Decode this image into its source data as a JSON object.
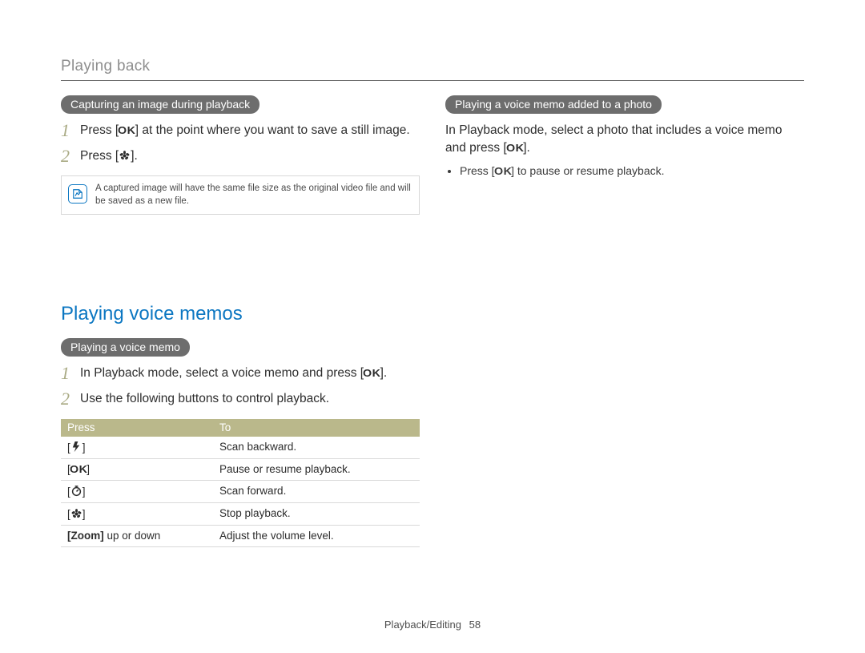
{
  "header": {
    "section_label": "Playing back"
  },
  "left": {
    "sub1": {
      "pill": "Capturing an image during playback",
      "steps": [
        {
          "n": "1",
          "pre": "Press [",
          "icon": "ok",
          "post": "] at the point where you want to save a still image."
        },
        {
          "n": "2",
          "pre": "Press [",
          "icon": "flower",
          "post": "]."
        }
      ],
      "note": "A captured image will have the same file size as the original video file and will be saved as a new file."
    },
    "section_title": "Playing voice memos",
    "sub2": {
      "pill": "Playing a voice memo",
      "steps": [
        {
          "n": "1",
          "pre": "In Playback mode, select a voice memo and press [",
          "icon": "ok",
          "post": "]."
        },
        {
          "n": "2",
          "text": "Use the following buttons to control playback."
        }
      ],
      "table": {
        "head": [
          "Press",
          "To"
        ],
        "rows": [
          {
            "icon": "flash",
            "label_pre": "[",
            "label_post": "]",
            "to": "Scan backward."
          },
          {
            "icon": "ok",
            "label_pre": "[",
            "label_post": "]",
            "to": "Pause or resume playback."
          },
          {
            "icon": "timer",
            "label_pre": "[",
            "label_post": "]",
            "to": "Scan forward."
          },
          {
            "icon": "flower",
            "label_pre": "[",
            "label_post": "]",
            "to": "Stop playback."
          },
          {
            "text_key": "[Zoom] up or down",
            "to": "Adjust the volume level."
          }
        ]
      }
    }
  },
  "right": {
    "sub": {
      "pill": "Playing a voice memo added to a photo",
      "para_pre": "In Playback mode, select a photo that includes a voice memo and press [",
      "para_icon": "ok",
      "para_post": "].",
      "bullet_pre": "Press [",
      "bullet_icon": "ok",
      "bullet_post": "] to pause or resume playback."
    }
  },
  "footer": {
    "label": "Playback/Editing",
    "page": "58"
  }
}
